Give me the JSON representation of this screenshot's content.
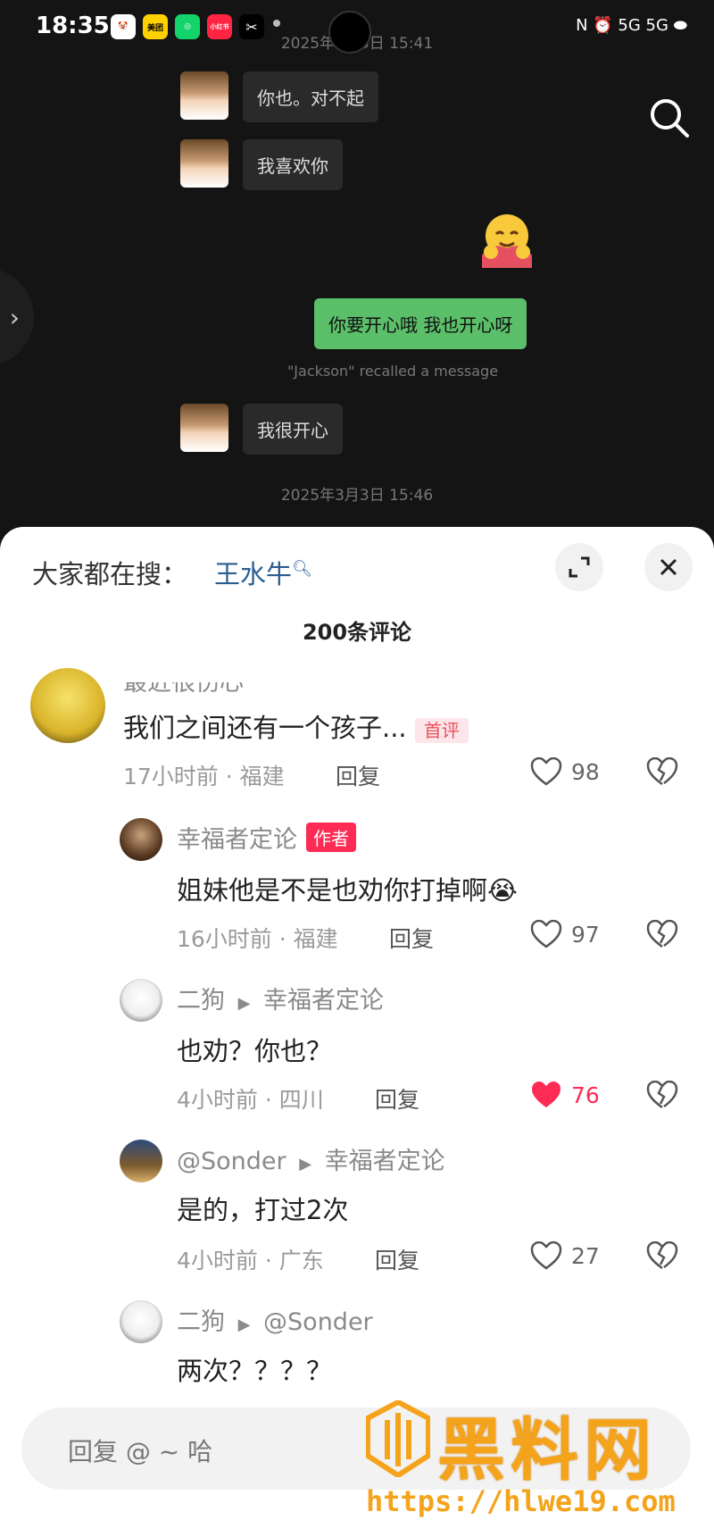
{
  "status_bar": {
    "time": "18:35",
    "apps": [
      {
        "name": "clown-app-icon",
        "color": "#ffffff",
        "label": ""
      },
      {
        "name": "meituan-icon",
        "color": "#ffd100",
        "label": "美团"
      },
      {
        "name": "green-app-icon",
        "color": "#13d36b",
        "label": ""
      },
      {
        "name": "xiaohongshu-icon",
        "color": "#ff2442",
        "label": "小红书"
      },
      {
        "name": "capcut-icon",
        "color": "#000000",
        "label": ""
      }
    ],
    "right_indicators": "N  ⏰  5G  5G  ⬬"
  },
  "chat": {
    "timestamp_top": "2025年3月3日 15:41",
    "messages": [
      {
        "side": "left",
        "text": "你也。对不起"
      },
      {
        "side": "left",
        "text": "我喜欢你"
      },
      {
        "side": "right",
        "text": "你要开心哦 我也开心呀"
      },
      {
        "side": "left",
        "text": "我很开心"
      }
    ],
    "recall_notice": "\"Jackson\" recalled a message",
    "timestamp_bottom": "2025年3月3日 15:46"
  },
  "comments_panel": {
    "trending_label": "大家都在搜：",
    "trending_term": "王水牛",
    "count_title": "200条评论",
    "comments": [
      {
        "name": "最近很伤心",
        "text": "我们之间还有一个孩子...",
        "tag": "首评",
        "meta": "17小时前 · 福建",
        "reply": "回复",
        "likes": "98",
        "liked": false
      },
      {
        "name": "幸福者定论",
        "tag": "作者",
        "text": "姐妹他是不是也劝你打掉啊",
        "meta": "16小时前 · 福建",
        "reply": "回复",
        "likes": "97",
        "liked": false
      },
      {
        "name": "二狗",
        "reply_to": "幸福者定论",
        "text": "也劝？你也？",
        "meta": "4小时前 · 四川",
        "reply": "回复",
        "likes": "76",
        "liked": true
      },
      {
        "name": "@Sonder",
        "reply_to": "幸福者定论",
        "text": "是的，打过2次",
        "meta": "4小时前 · 广东",
        "reply": "回复",
        "likes": "27",
        "liked": false
      },
      {
        "name": "二狗",
        "reply_to": "@Sonder",
        "text": "两次？？？？"
      }
    ],
    "reply_placeholder": "回复 @ ~ 哈"
  },
  "watermark": {
    "text": "黑料网",
    "url": "https://hlwe19.com"
  }
}
